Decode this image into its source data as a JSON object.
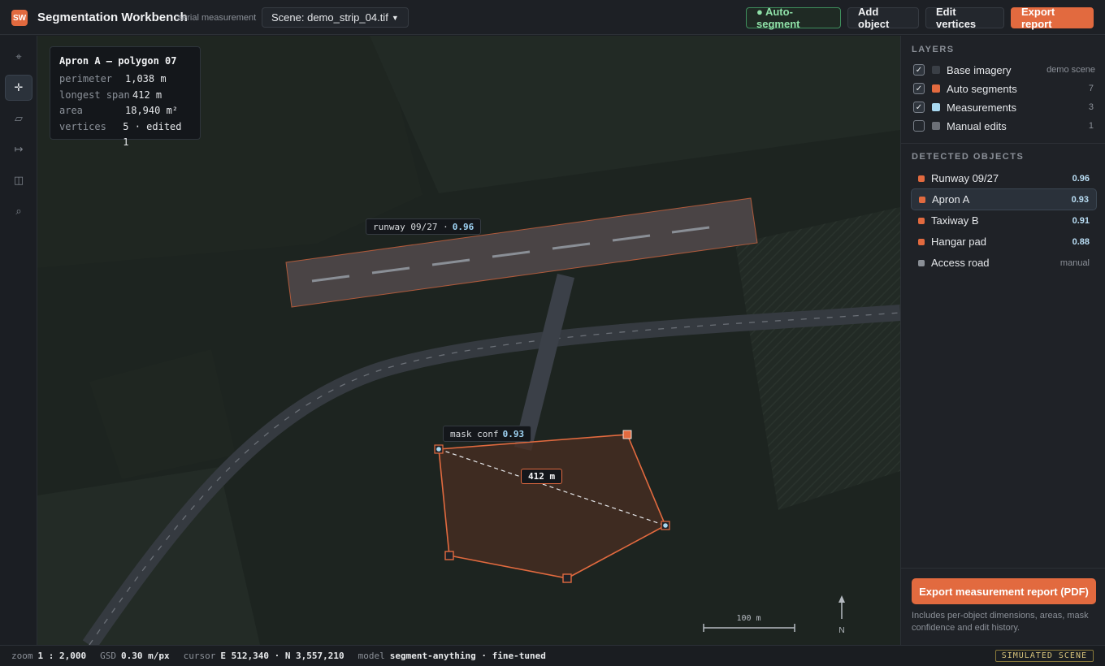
{
  "app": {
    "logo": "SW",
    "title": "Segmentation Workbench",
    "subtitle": "aerial measurement",
    "scene_select": "Scene: demo_strip_04.tif"
  },
  "toolbar": {
    "auto_segment": "● Auto-segment",
    "add_object": "Add object",
    "edit_vertices": "Edit vertices",
    "export_report": "Export report"
  },
  "tools": [
    {
      "name": "crosshair",
      "glyph": "⌖"
    },
    {
      "name": "move",
      "glyph": "✛"
    },
    {
      "name": "polygon",
      "glyph": "▱"
    },
    {
      "name": "measure",
      "glyph": "↦"
    },
    {
      "name": "compare",
      "glyph": "◫"
    },
    {
      "name": "zoom",
      "glyph": "⌕"
    }
  ],
  "info_card": {
    "title": "Apron A — polygon 07",
    "rows": [
      {
        "key": "perimeter",
        "value": "1,038 m"
      },
      {
        "key": "longest span",
        "value": "412 m"
      },
      {
        "key": "area",
        "value": "18,940 m²"
      },
      {
        "key": "vertices",
        "value": "5 · edited 1"
      }
    ]
  },
  "map_labels": {
    "runway_prefix": "runway 09/27 ·",
    "runway_conf": "0.96",
    "mask_prefix": "mask conf",
    "mask_conf": "0.93",
    "span": "412 m"
  },
  "scale": {
    "label": "100 m",
    "north": "N"
  },
  "layers": {
    "title": "LAYERS",
    "items": [
      {
        "name": "Base imagery",
        "count": "demo scene",
        "checked": true,
        "color": "#3a3f46"
      },
      {
        "name": "Auto segments",
        "count": "7",
        "checked": true,
        "color": "#e26a3f"
      },
      {
        "name": "Measurements",
        "count": "3",
        "checked": true,
        "color": "#a8d8f0"
      },
      {
        "name": "Manual edits",
        "count": "1",
        "checked": false,
        "color": "#6c7077"
      }
    ]
  },
  "objects": {
    "title": "DETECTED OBJECTS",
    "items": [
      {
        "name": "Runway 09/27",
        "conf": "0.96",
        "color": "#e26a3f"
      },
      {
        "name": "Apron A",
        "conf": "0.93",
        "color": "#e26a3f",
        "selected": true
      },
      {
        "name": "Taxiway B",
        "conf": "0.91",
        "color": "#e26a3f"
      },
      {
        "name": "Hangar pad",
        "conf": "0.88",
        "color": "#e26a3f"
      },
      {
        "name": "Access road",
        "conf": "manual",
        "color": "#8a8f96"
      }
    ]
  },
  "export": {
    "button": "Export measurement report (PDF)",
    "note": "Includes per-object dimensions, areas, mask confidence and edit history."
  },
  "status": {
    "zoom_label": "zoom",
    "zoom_value": "1 : 2,000",
    "gsd_label": "GSD",
    "gsd_value": "0.30 m/px",
    "cursor_label": "cursor",
    "cursor_value": "E 512,340 · N 3,557,210",
    "model_label": "model",
    "model_value": "segment-anything · fine-tuned",
    "badge": "SIMULATED SCENE"
  }
}
